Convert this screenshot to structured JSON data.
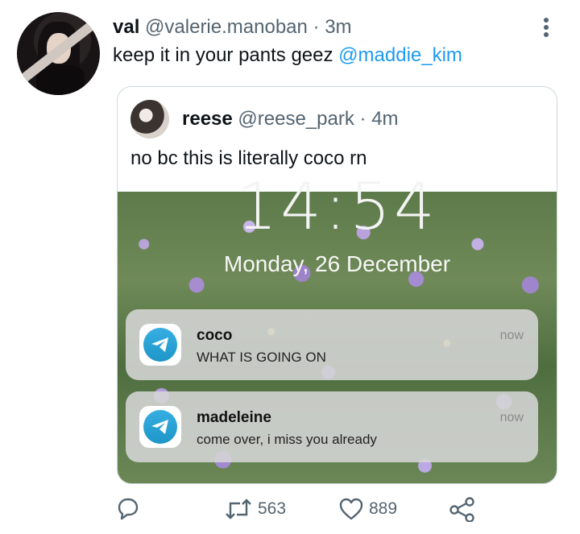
{
  "tweet": {
    "display_name": "val",
    "handle": "@valerie.manoban",
    "separator": "·",
    "time": "3m",
    "text": "keep it in your pants geez ",
    "mention": "@maddie_kim"
  },
  "quoted": {
    "display_name": "reese",
    "handle": "@reese_park",
    "separator": "·",
    "time": "4m",
    "text": "no bc this is literally coco rn",
    "media": {
      "clock": "14:54",
      "date": "Monday, 26 December",
      "notifications": [
        {
          "title": "coco",
          "body": "WHAT IS GOING ON",
          "time": "now"
        },
        {
          "title": "madeleine",
          "body": "come over, i miss you already",
          "time": "now"
        }
      ]
    }
  },
  "actions": {
    "reply_count": "",
    "retweet_count": "563",
    "like_count": "889"
  },
  "icons": [
    "more-vertical-icon",
    "telegram-icon",
    "reply-icon",
    "retweet-icon",
    "like-icon",
    "share-icon"
  ],
  "colors": {
    "link": "#1d9bf0",
    "muted": "#536471",
    "border": "#cfd9de"
  }
}
